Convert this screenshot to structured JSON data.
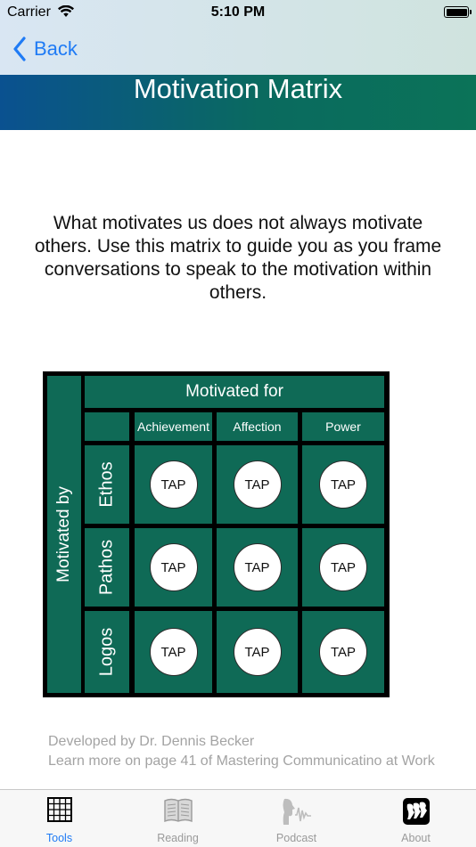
{
  "status": {
    "carrier": "Carrier",
    "time": "5:10 PM"
  },
  "nav": {
    "back_label": "Back"
  },
  "header": {
    "title": "Motivation Matrix"
  },
  "intro": "What motivates us does not always motivate others.  Use this matrix to guide you as you frame conversations to speak to the motivation within others.",
  "matrix": {
    "col_header": "Motivated for",
    "row_header": "Motivated by",
    "columns": [
      "Achievement",
      "Affection",
      "Power"
    ],
    "rows": [
      "Ethos",
      "Pathos",
      "Logos"
    ],
    "tap_label": "TAP"
  },
  "credit": {
    "line1": "Developed by Dr. Dennis Becker",
    "line2": "Learn more on page 41 of Mastering Communicatino at Work"
  },
  "tabs": [
    {
      "label": "Tools",
      "icon": "grid-icon",
      "active": true
    },
    {
      "label": "Reading",
      "icon": "book-icon",
      "active": false
    },
    {
      "label": "Podcast",
      "icon": "podcast-speaker-icon",
      "active": false
    },
    {
      "label": "About",
      "icon": "about-logo-icon",
      "active": false
    }
  ],
  "colors": {
    "accent": "#1f7bf5",
    "matrix_green": "#0f6a56",
    "title_blue": "#0a5190"
  }
}
